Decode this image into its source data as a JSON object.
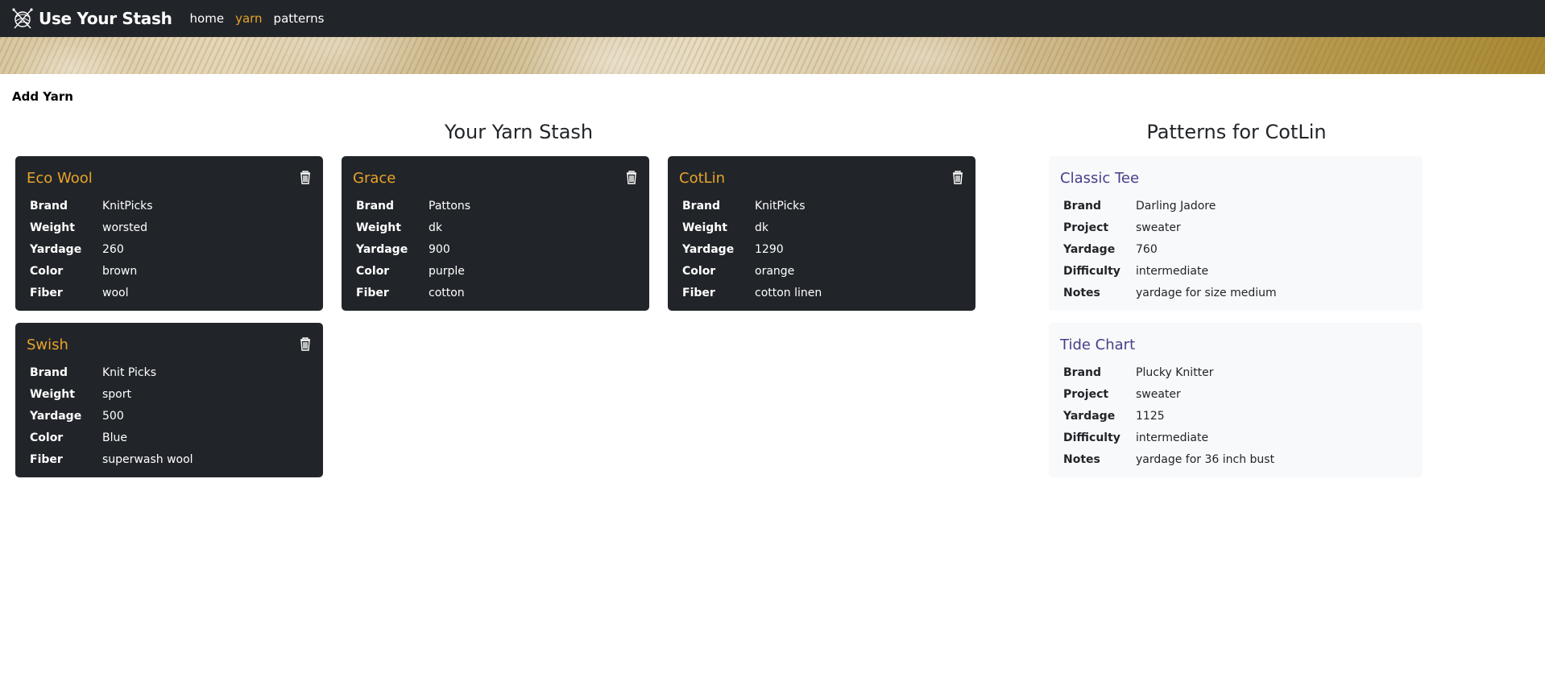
{
  "nav": {
    "brand": "Use Your Stash",
    "links": [
      {
        "label": "home",
        "active": false
      },
      {
        "label": "yarn",
        "active": true
      },
      {
        "label": "patterns",
        "active": false
      }
    ]
  },
  "add_yarn_label": "Add Yarn",
  "stash": {
    "title": "Your Yarn Stash",
    "yarns": [
      {
        "name": "Eco Wool",
        "rows": [
          {
            "label": "Brand",
            "value": "KnitPicks"
          },
          {
            "label": "Weight",
            "value": "worsted"
          },
          {
            "label": "Yardage",
            "value": "260"
          },
          {
            "label": "Color",
            "value": "brown"
          },
          {
            "label": "Fiber",
            "value": "wool"
          }
        ]
      },
      {
        "name": "Grace",
        "rows": [
          {
            "label": "Brand",
            "value": "Pattons"
          },
          {
            "label": "Weight",
            "value": "dk"
          },
          {
            "label": "Yardage",
            "value": "900"
          },
          {
            "label": "Color",
            "value": "purple"
          },
          {
            "label": "Fiber",
            "value": "cotton"
          }
        ]
      },
      {
        "name": "CotLin",
        "rows": [
          {
            "label": "Brand",
            "value": "KnitPicks"
          },
          {
            "label": "Weight",
            "value": "dk"
          },
          {
            "label": "Yardage",
            "value": "1290"
          },
          {
            "label": "Color",
            "value": "orange"
          },
          {
            "label": "Fiber",
            "value": "cotton linen"
          }
        ]
      },
      {
        "name": "Swish",
        "rows": [
          {
            "label": "Brand",
            "value": "Knit Picks"
          },
          {
            "label": "Weight",
            "value": "sport"
          },
          {
            "label": "Yardage",
            "value": "500"
          },
          {
            "label": "Color",
            "value": "Blue"
          },
          {
            "label": "Fiber",
            "value": "superwash wool"
          }
        ]
      }
    ]
  },
  "patterns": {
    "title": "Patterns for CotLin",
    "items": [
      {
        "name": "Classic Tee",
        "rows": [
          {
            "label": "Brand",
            "value": "Darling Jadore"
          },
          {
            "label": "Project",
            "value": "sweater"
          },
          {
            "label": "Yardage",
            "value": "760"
          },
          {
            "label": "Difficulty",
            "value": "intermediate"
          },
          {
            "label": "Notes",
            "value": "yardage for size medium"
          }
        ]
      },
      {
        "name": "Tide Chart",
        "rows": [
          {
            "label": "Brand",
            "value": "Plucky Knitter"
          },
          {
            "label": "Project",
            "value": "sweater"
          },
          {
            "label": "Yardage",
            "value": "1125"
          },
          {
            "label": "Difficulty",
            "value": "intermediate"
          },
          {
            "label": "Notes",
            "value": "yardage for 36 inch bust"
          }
        ]
      }
    ]
  },
  "colors": {
    "navbar": "#212529",
    "accent": "#e8a32a",
    "pattern_title": "#483d8b",
    "light_card": "#f8f9fa"
  }
}
